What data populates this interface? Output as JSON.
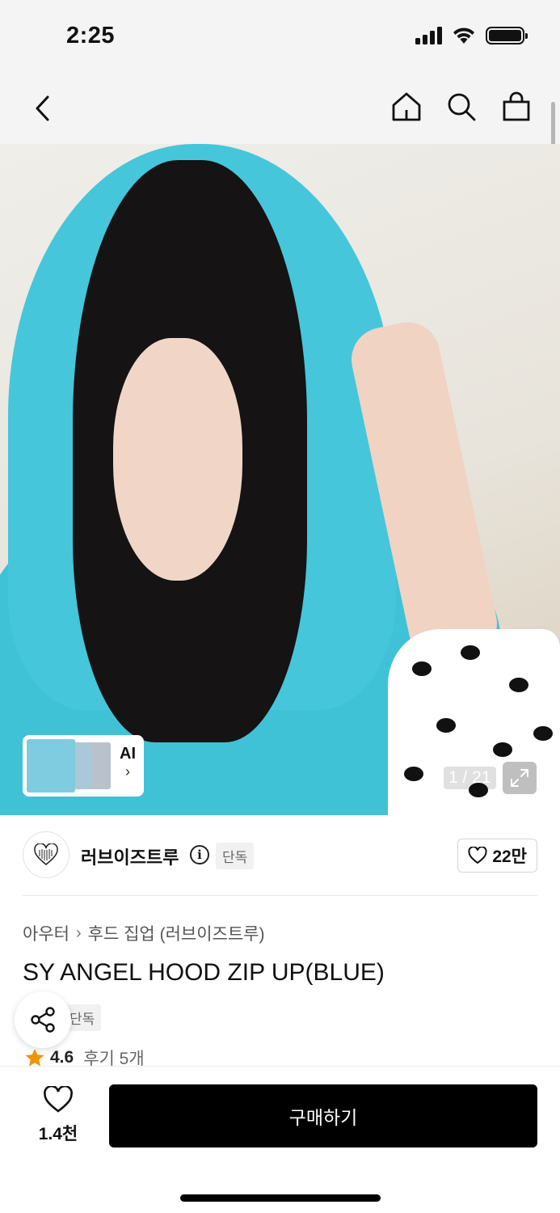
{
  "status_bar": {
    "time": "2:25"
  },
  "product_image": {
    "page_counter": "1 / 21",
    "ai_label": "AI",
    "ai_arrow": "›"
  },
  "brand": {
    "name": "러브이즈트루",
    "info_glyph": "i",
    "badge": "단독",
    "likes": "22만"
  },
  "breadcrumb": {
    "category": "아우터",
    "separator": "›",
    "subcategory": "후드 집업 (러브이즈트루)"
  },
  "product": {
    "title": "SY ANGEL HOOD ZIP UP(BLUE)",
    "badge": "단독",
    "rating": "4.6",
    "reviews": "후기 5개"
  },
  "bottom_bar": {
    "wish_count": "1.4천",
    "buy_label": "구매하기"
  },
  "colors": {
    "accent": "#000000",
    "star": "#f29300",
    "hoodie": "#46c6da"
  }
}
